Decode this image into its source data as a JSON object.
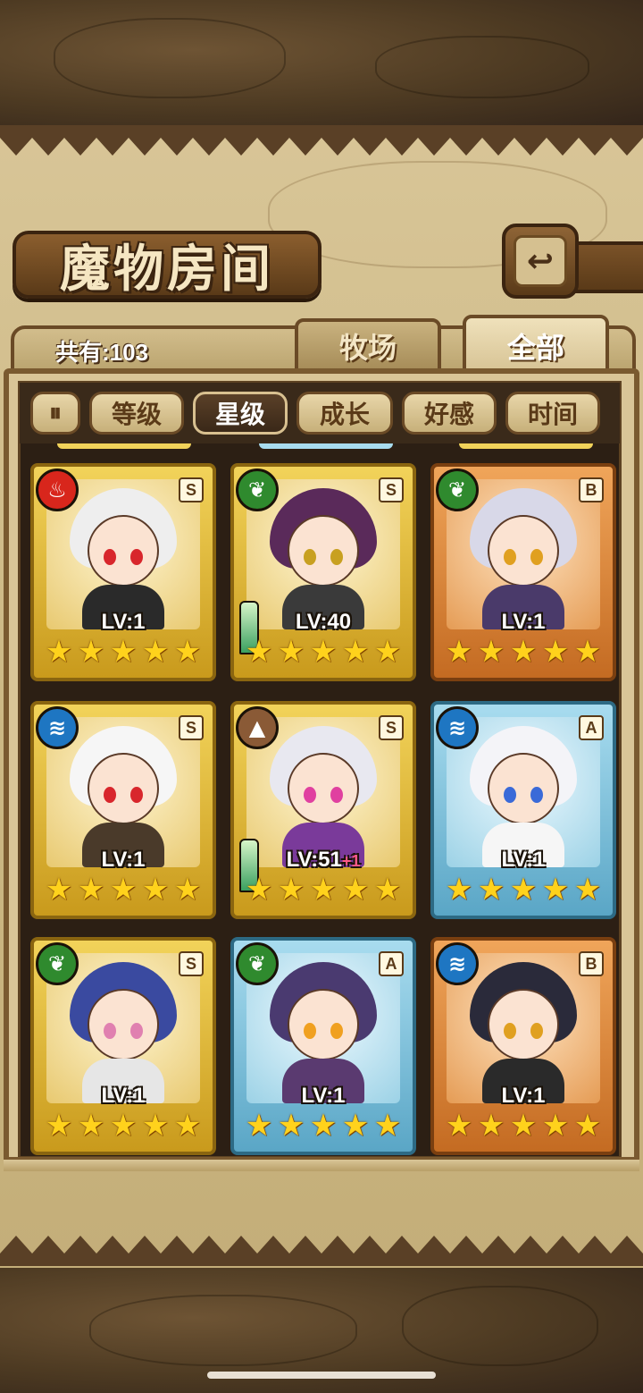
{
  "title": "魔物房间",
  "back_icon": "↩",
  "count_label": "共有:103",
  "tabs": [
    {
      "label": "牧场",
      "active": false
    },
    {
      "label": "全部",
      "active": true
    }
  ],
  "filters": [
    {
      "label": "⏸",
      "icon": "pause-icon",
      "active": false
    },
    {
      "label": "等级",
      "active": false
    },
    {
      "label": "星级",
      "active": true
    },
    {
      "label": "成长",
      "active": false
    },
    {
      "label": "好感",
      "active": false
    },
    {
      "label": "时间",
      "active": false
    }
  ],
  "monsters": [
    {
      "element": "fire",
      "rank": "S",
      "frame": "gold",
      "level": "LV:1",
      "bonus": "",
      "stars": 5,
      "weapon": false
    },
    {
      "element": "grass",
      "rank": "S",
      "frame": "gold",
      "level": "LV:40",
      "bonus": "",
      "stars": 5,
      "weapon": true
    },
    {
      "element": "grass",
      "rank": "B",
      "frame": "orange",
      "level": "LV:1",
      "bonus": "",
      "stars": 5,
      "weapon": false
    },
    {
      "element": "water",
      "rank": "S",
      "frame": "gold",
      "level": "LV:1",
      "bonus": "",
      "stars": 5,
      "weapon": false
    },
    {
      "element": "earth",
      "rank": "S",
      "frame": "gold",
      "level": "LV:51",
      "bonus": "+1",
      "stars": 5,
      "weapon": true
    },
    {
      "element": "water",
      "rank": "A",
      "frame": "blue",
      "level": "LV:1",
      "bonus": "",
      "stars": 5,
      "weapon": false
    },
    {
      "element": "grass",
      "rank": "S",
      "frame": "gold",
      "level": "LV:1",
      "bonus": "",
      "stars": 5,
      "weapon": false
    },
    {
      "element": "grass",
      "rank": "A",
      "frame": "blue",
      "level": "LV:1",
      "bonus": "",
      "stars": 5,
      "weapon": false
    },
    {
      "element": "water",
      "rank": "B",
      "frame": "orange",
      "level": "LV:1",
      "bonus": "",
      "stars": 5,
      "weapon": false
    }
  ],
  "element_icons": {
    "fire": "fire-icon",
    "grass": "leaf-icon",
    "water": "water-icon",
    "earth": "mountain-icon"
  },
  "element_glyphs": {
    "fire": "♨",
    "grass": "❦",
    "water": "≋",
    "earth": "▲"
  },
  "colors": {
    "gold_frame": "#f2d35a",
    "orange_frame": "#f0a55a",
    "blue_frame": "#a8dcef",
    "star": "#ffd21c"
  }
}
